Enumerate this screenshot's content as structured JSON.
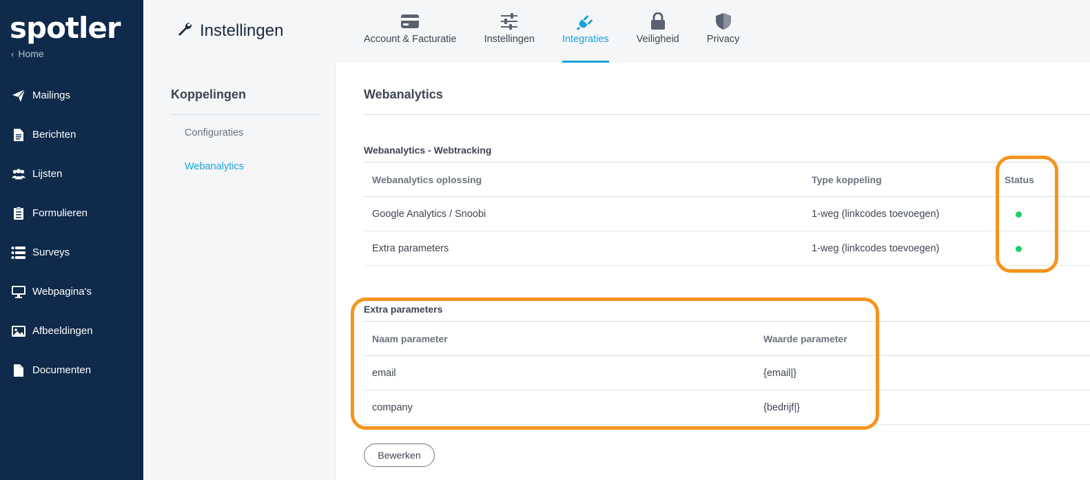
{
  "app": {
    "logo_text": "spotler",
    "home_label": "Home"
  },
  "sidebar": {
    "items": [
      {
        "label": "Mailings",
        "icon": "paper-plane-icon"
      },
      {
        "label": "Berichten",
        "icon": "document-icon"
      },
      {
        "label": "Lijsten",
        "icon": "users-icon"
      },
      {
        "label": "Formulieren",
        "icon": "form-icon"
      },
      {
        "label": "Surveys",
        "icon": "survey-icon"
      },
      {
        "label": "Webpagina's",
        "icon": "monitor-icon"
      },
      {
        "label": "Afbeeldingen",
        "icon": "image-icon"
      },
      {
        "label": "Documenten",
        "icon": "file-icon"
      }
    ]
  },
  "header": {
    "title": "Instellingen",
    "tabs": [
      {
        "label": "Account & Facturatie",
        "icon": "credit-card-icon",
        "active": false
      },
      {
        "label": "Instellingen",
        "icon": "sliders-icon",
        "active": false
      },
      {
        "label": "Integraties",
        "icon": "plug-icon",
        "active": true
      },
      {
        "label": "Veiligheid",
        "icon": "lock-icon",
        "active": false
      },
      {
        "label": "Privacy",
        "icon": "shield-icon",
        "active": false
      }
    ]
  },
  "subnav": {
    "title": "Koppelingen",
    "items": [
      {
        "label": "Configuraties",
        "active": false
      },
      {
        "label": "Webanalytics",
        "active": true
      }
    ]
  },
  "main": {
    "title": "Webanalytics",
    "webtracking": {
      "title": "Webanalytics - Webtracking",
      "headers": [
        "Webanalytics oplossing",
        "Type koppeling",
        "Status"
      ],
      "rows": [
        {
          "solution": "Google Analytics / Snoobi",
          "type": "1-weg (linkcodes toevoegen)",
          "status": "active"
        },
        {
          "solution": "Extra parameters",
          "type": "1-weg (linkcodes toevoegen)",
          "status": "active"
        }
      ]
    },
    "extra_params": {
      "title": "Extra parameters",
      "headers": [
        "Naam parameter",
        "Waarde parameter"
      ],
      "rows": [
        {
          "name": "email",
          "value": "{email|}"
        },
        {
          "name": "company",
          "value": "{bedrijf|}"
        }
      ]
    },
    "edit_button": "Bewerken"
  },
  "colors": {
    "sidebar_bg": "#0f2a4a",
    "accent": "#1aa3d9",
    "status_active": "#19d26a",
    "highlight": "#f7931e"
  }
}
